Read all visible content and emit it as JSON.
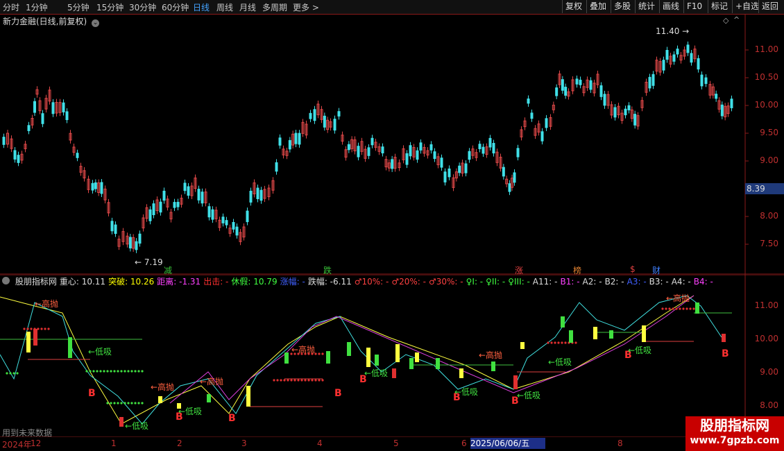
{
  "toolbar": {
    "periods": [
      "分时",
      "1分钟",
      "5分钟",
      "15分钟",
      "30分钟",
      "60分钟",
      "日线",
      "周线",
      "月线",
      "多周期",
      "更多 >"
    ],
    "active_period": "日线",
    "right_buttons": [
      "复权",
      "叠加",
      "多股",
      "统计",
      "画线",
      "F10",
      "标记",
      "+自选",
      "返回"
    ]
  },
  "title": "新力金融(日线,前复权)",
  "main_axis": [
    "11.00",
    "10.50",
    "10.00",
    "9.50",
    "9.00",
    "8.50",
    "8.00",
    "7.50"
  ],
  "current_price": "8.39",
  "high_label": "11.40",
  "low_label": "7.19",
  "event_markers": [
    {
      "text": "减",
      "color": "#38c038"
    },
    {
      "text": "跌",
      "color": "#38c038"
    },
    {
      "text": "涨",
      "color": "#e04040"
    },
    {
      "text": "榜",
      "color": "#e08030"
    },
    {
      "text": "$",
      "color": "#e04040"
    },
    {
      "text": "财",
      "color": "#4080ff"
    }
  ],
  "indicator_header": [
    {
      "text": "股朋指标网",
      "color": "#dddddd"
    },
    {
      "text": "重心: 10.11",
      "color": "#dddddd"
    },
    {
      "text": "突破: 10.26",
      "color": "#ffff00"
    },
    {
      "text": "距离: -1.31",
      "color": "#ff40ff"
    },
    {
      "text": "出击: -",
      "color": "#ff3030"
    },
    {
      "text": "休假: 10.79",
      "color": "#40ff40"
    },
    {
      "text": "涨幅: -",
      "color": "#4060ff"
    },
    {
      "text": "跌幅: -6.11",
      "color": "#dddddd"
    },
    {
      "text": "♂10%: -",
      "color": "#ff4040"
    },
    {
      "text": "♂20%: -",
      "color": "#ff4040"
    },
    {
      "text": "♂30%: -",
      "color": "#ff4040"
    },
    {
      "text": "♀I: -",
      "color": "#40ff40"
    },
    {
      "text": "♀II: -",
      "color": "#40ff40"
    },
    {
      "text": "♀III: -",
      "color": "#40ff40"
    },
    {
      "text": "A11: -",
      "color": "#dddddd"
    },
    {
      "text": "B1: -",
      "color": "#ff40ff"
    },
    {
      "text": "A2: -",
      "color": "#dddddd"
    },
    {
      "text": "B2: -",
      "color": "#dddddd"
    },
    {
      "text": "A3: -",
      "color": "#4060ff"
    },
    {
      "text": "B3: -",
      "color": "#dddddd"
    },
    {
      "text": "A4: -",
      "color": "#dddddd"
    },
    {
      "text": "B4: -",
      "color": "#ff40ff"
    }
  ],
  "ind_axis": [
    "11.00",
    "10.00",
    "9.00",
    "8.00"
  ],
  "date_axis": [
    "2024年",
    "12",
    "1",
    "2",
    "3",
    "4",
    "5",
    "6",
    "7",
    "8"
  ],
  "date_highlight": "2025/06/06/五",
  "future_note": "用到未来数据",
  "watermark": {
    "title": "股朋指标网",
    "url": "www.7gpzb.com"
  },
  "signals": [
    "高抛",
    "低吸",
    "高抛",
    "低吸",
    "高抛",
    "低吸",
    "低吸",
    "高抛",
    "低吸",
    "高抛",
    "低吸",
    "低吸",
    "低吸",
    "高抛"
  ],
  "colors": {
    "up": "#e04848",
    "down": "#40e0e8",
    "axis": "#8b1a1a"
  }
}
